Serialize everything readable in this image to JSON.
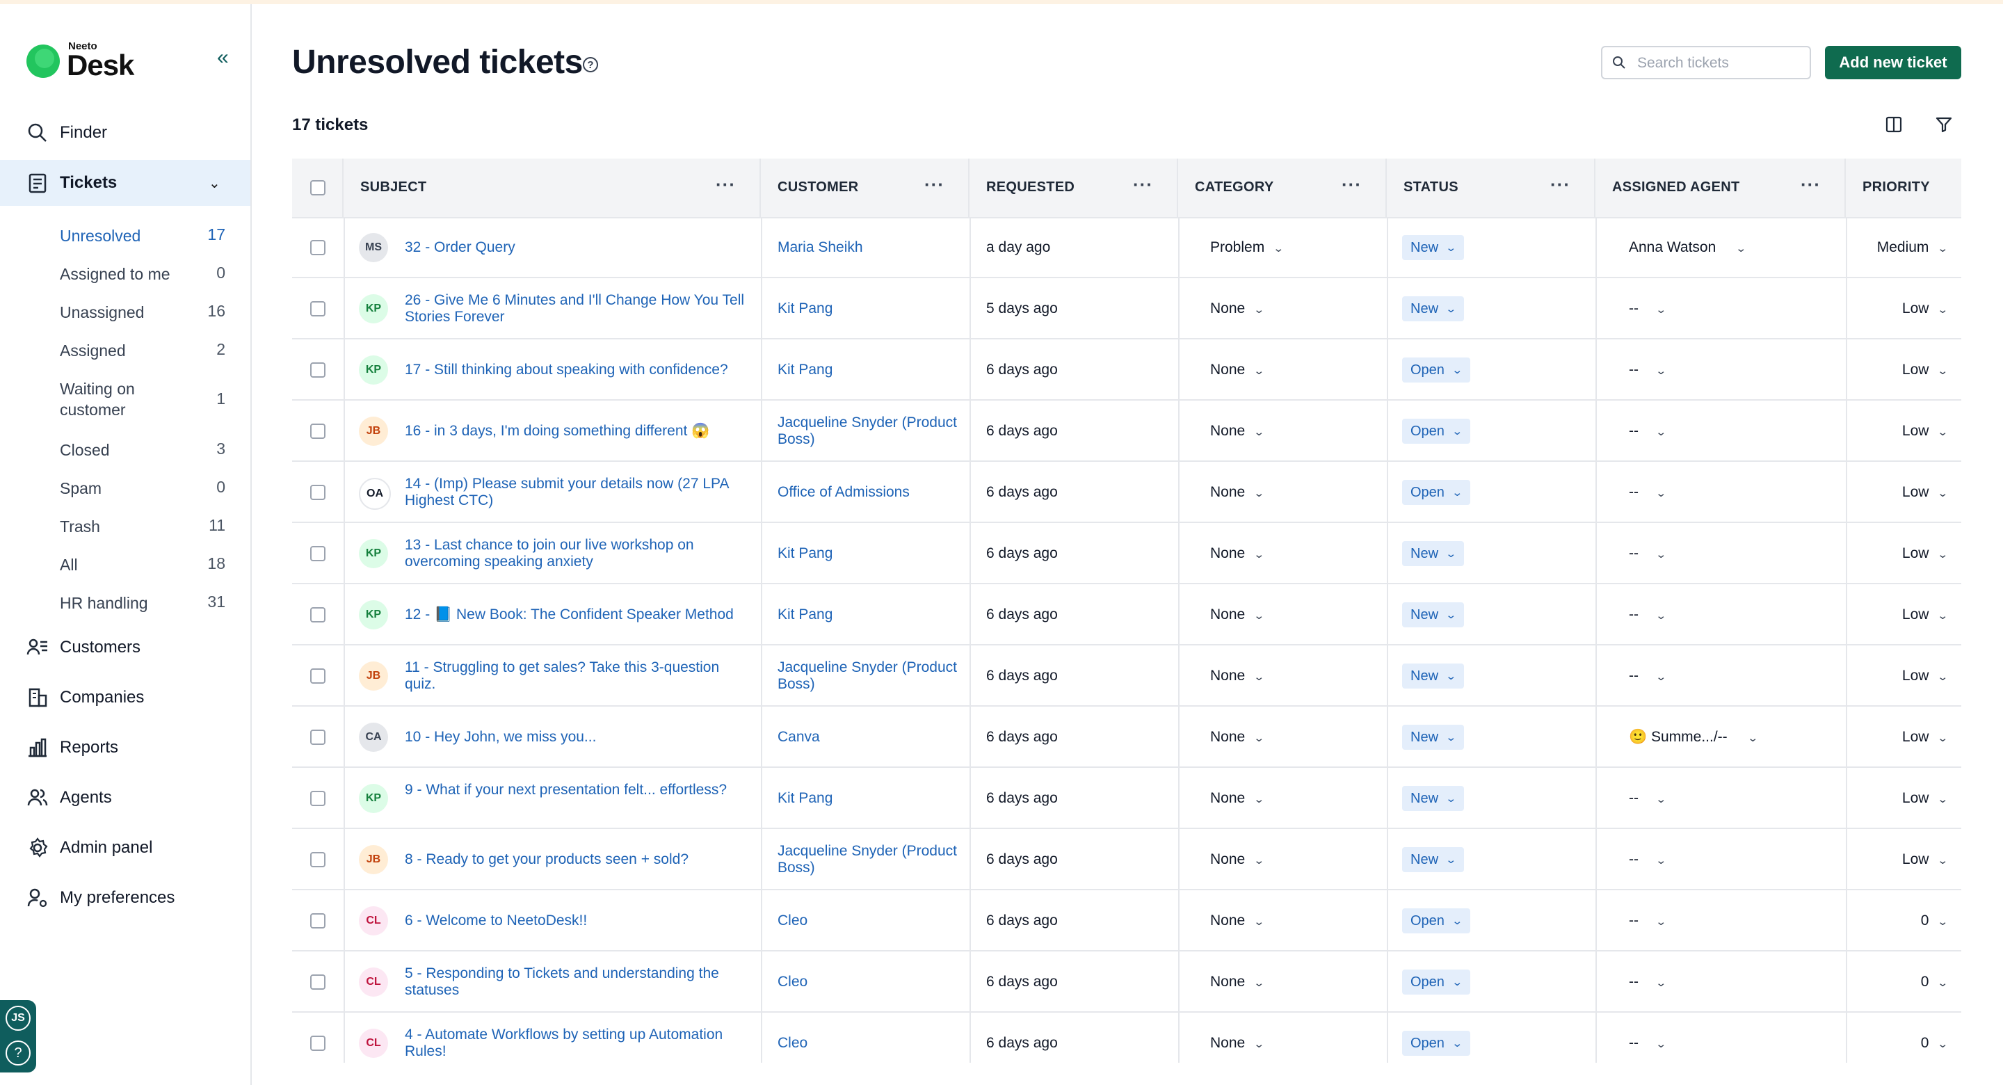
{
  "app": {
    "logo_small": "Neeto",
    "logo_big": "Desk"
  },
  "sidebar": {
    "finder": "Finder",
    "tickets": "Tickets",
    "sub_items": [
      {
        "label": "Unresolved",
        "count": "17"
      },
      {
        "label": "Assigned to me",
        "count": "0"
      },
      {
        "label": "Unassigned",
        "count": "16"
      },
      {
        "label": "Assigned",
        "count": "2"
      },
      {
        "label": "Waiting on customer",
        "count": "1"
      },
      {
        "label": "Closed",
        "count": "3"
      },
      {
        "label": "Spam",
        "count": "0"
      },
      {
        "label": "Trash",
        "count": "11"
      },
      {
        "label": "All",
        "count": "18"
      },
      {
        "label": "HR handling",
        "count": "31"
      }
    ],
    "customers": "Customers",
    "companies": "Companies",
    "reports": "Reports",
    "agents": "Agents",
    "admin_panel": "Admin panel",
    "my_preferences": "My preferences",
    "user_initials": "JS",
    "help_glyph": "?"
  },
  "header": {
    "title": "Unresolved tickets",
    "help_glyph": "?",
    "search_placeholder": "Search tickets",
    "add_button": "Add new ticket",
    "ticket_count": "17 tickets"
  },
  "table": {
    "columns": {
      "subject": "SUBJECT",
      "customer": "CUSTOMER",
      "requested": "REQUESTED",
      "category": "CATEGORY",
      "status": "STATUS",
      "assigned_agent": "ASSIGNED AGENT",
      "priority": "PRIORITY",
      "menu_glyph": "···"
    },
    "rows": [
      {
        "initials": "MS",
        "avatar_bg": "#e5e7eb",
        "avatar_fg": "#374151",
        "subject": "32 - Order Query",
        "customer": "Maria Sheikh",
        "requested": "a day ago",
        "category": "Problem",
        "status": "New",
        "agent": "Anna Watson",
        "priority": "Medium"
      },
      {
        "initials": "KP",
        "avatar_bg": "#dcfce7",
        "avatar_fg": "#15803d",
        "subject": "26 - Give Me 6 Minutes and I'll Change How You Tell Stories Forever",
        "customer": "Kit Pang",
        "requested": "5 days ago",
        "category": "None",
        "status": "New",
        "agent": "--",
        "priority": "Low"
      },
      {
        "initials": "KP",
        "avatar_bg": "#dcfce7",
        "avatar_fg": "#15803d",
        "subject": "17 - Still thinking about speaking with confidence?",
        "customer": "Kit Pang",
        "requested": "6 days ago",
        "category": "None",
        "status": "Open",
        "agent": "--",
        "priority": "Low"
      },
      {
        "initials": "JB",
        "avatar_bg": "#ffedd5",
        "avatar_fg": "#c2410c",
        "subject": "16 - in 3 days, I'm doing something different 😱",
        "customer": "Jacqueline Snyder (Product Boss)",
        "requested": "6 days ago",
        "category": "None",
        "status": "Open",
        "agent": "--",
        "priority": "Low"
      },
      {
        "initials": "OA",
        "avatar_bg": "#ffffff",
        "avatar_fg": "#111827",
        "subject": "14 - (Imp) Please submit your details now (27 LPA Highest CTC)",
        "customer": "Office of Admissions",
        "requested": "6 days ago",
        "category": "None",
        "status": "Open",
        "agent": "--",
        "priority": "Low"
      },
      {
        "initials": "KP",
        "avatar_bg": "#dcfce7",
        "avatar_fg": "#15803d",
        "subject": "13 - Last chance to join our live workshop on overcoming speaking anxiety",
        "customer": "Kit Pang",
        "requested": "6 days ago",
        "category": "None",
        "status": "New",
        "agent": "--",
        "priority": "Low"
      },
      {
        "initials": "KP",
        "avatar_bg": "#dcfce7",
        "avatar_fg": "#15803d",
        "subject": "12 - 📘 New Book: The Confident Speaker Method",
        "customer": "Kit Pang",
        "requested": "6 days ago",
        "category": "None",
        "status": "New",
        "agent": "--",
        "priority": "Low"
      },
      {
        "initials": "JB",
        "avatar_bg": "#ffedd5",
        "avatar_fg": "#c2410c",
        "subject": "11 - Struggling to get sales? Take this 3-question quiz.",
        "customer": "Jacqueline Snyder (Product Boss)",
        "requested": "6 days ago",
        "category": "None",
        "status": "New",
        "agent": "--",
        "priority": "Low"
      },
      {
        "initials": "CA",
        "avatar_bg": "#e5e7eb",
        "avatar_fg": "#374151",
        "subject": "10 - Hey John, we miss you...",
        "customer": "Canva",
        "requested": "6 days ago",
        "category": "None",
        "status": "New",
        "agent": "🙂 Summe.../--",
        "priority": "Low"
      },
      {
        "initials": "KP",
        "avatar_bg": "#dcfce7",
        "avatar_fg": "#15803d",
        "subject": "9 - What if your next presentation felt... effortless?",
        "customer": "Kit Pang",
        "requested": "6 days ago",
        "category": "None",
        "status": "New",
        "agent": "--",
        "priority": "Low"
      },
      {
        "initials": "JB",
        "avatar_bg": "#ffedd5",
        "avatar_fg": "#c2410c",
        "subject": "8 - Ready to get your products seen + sold?",
        "customer": "Jacqueline Snyder (Product Boss)",
        "requested": "6 days ago",
        "category": "None",
        "status": "New",
        "agent": "--",
        "priority": "Low"
      },
      {
        "initials": "CL",
        "avatar_bg": "#fce7f3",
        "avatar_fg": "#be123c",
        "subject": "6 - Welcome to NeetoDesk!!",
        "customer": "Cleo",
        "requested": "6 days ago",
        "category": "None",
        "status": "Open",
        "agent": "--",
        "priority": "0"
      },
      {
        "initials": "CL",
        "avatar_bg": "#fce7f3",
        "avatar_fg": "#be123c",
        "subject": "5 - Responding to Tickets and understanding the statuses",
        "customer": "Cleo",
        "requested": "6 days ago",
        "category": "None",
        "status": "Open",
        "agent": "--",
        "priority": "0"
      },
      {
        "initials": "CL",
        "avatar_bg": "#fce7f3",
        "avatar_fg": "#be123c",
        "subject": "4 - Automate Workflows by setting up Automation Rules!",
        "customer": "Cleo",
        "requested": "6 days ago",
        "category": "None",
        "status": "Open",
        "agent": "--",
        "priority": "0"
      }
    ]
  },
  "colors": {
    "accent": "#0f6b4f",
    "link": "#1e63b6",
    "active_bg": "#e7f1fb"
  },
  "icons": [
    "double-chevron-left-icon",
    "search-icon",
    "tickets-icon",
    "customers-icon",
    "companies-icon",
    "reports-icon",
    "agents-icon",
    "gear-icon",
    "user-settings-icon",
    "columns-icon",
    "filter-icon",
    "help-icon"
  ]
}
